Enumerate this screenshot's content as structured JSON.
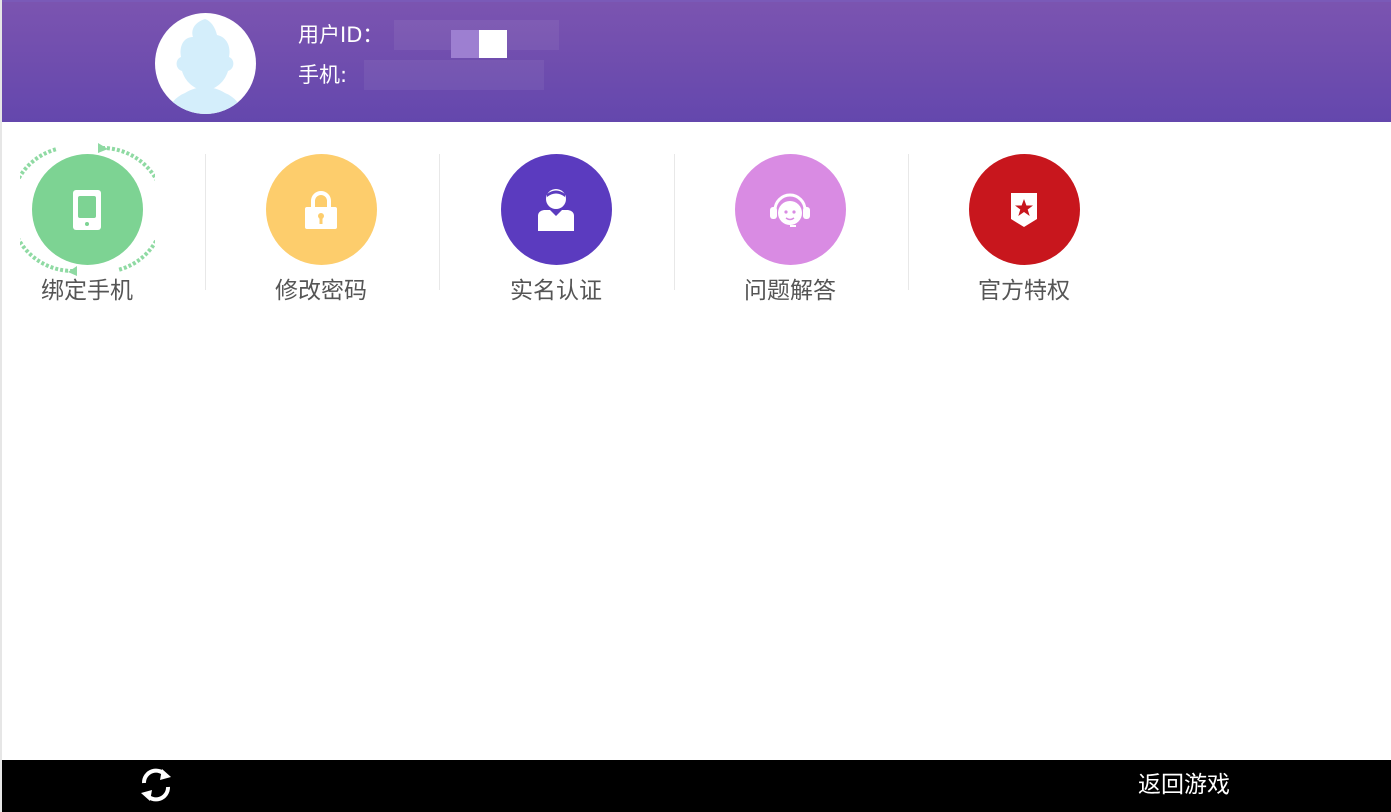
{
  "header": {
    "user_id_label": "用户ID：",
    "phone_label": "手机:"
  },
  "features": [
    {
      "label": "绑定手机",
      "icon": "phone-icon",
      "color": "#7dd393"
    },
    {
      "label": "修改密码",
      "icon": "lock-icon",
      "color": "#fdcd6c"
    },
    {
      "label": "实名认证",
      "icon": "user-id-icon",
      "color": "#5b3bbf"
    },
    {
      "label": "问题解答",
      "icon": "headset-icon",
      "color": "#d98be3"
    },
    {
      "label": "官方特权",
      "icon": "star-badge-icon",
      "color": "#c8161d"
    }
  ],
  "bottom_bar": {
    "refresh_icon": "refresh-icon",
    "return_label": "返回游戏"
  },
  "colors": {
    "header_top": "#7b54b0",
    "header_bottom": "#6447ad",
    "bottom_bar": "#000000"
  }
}
